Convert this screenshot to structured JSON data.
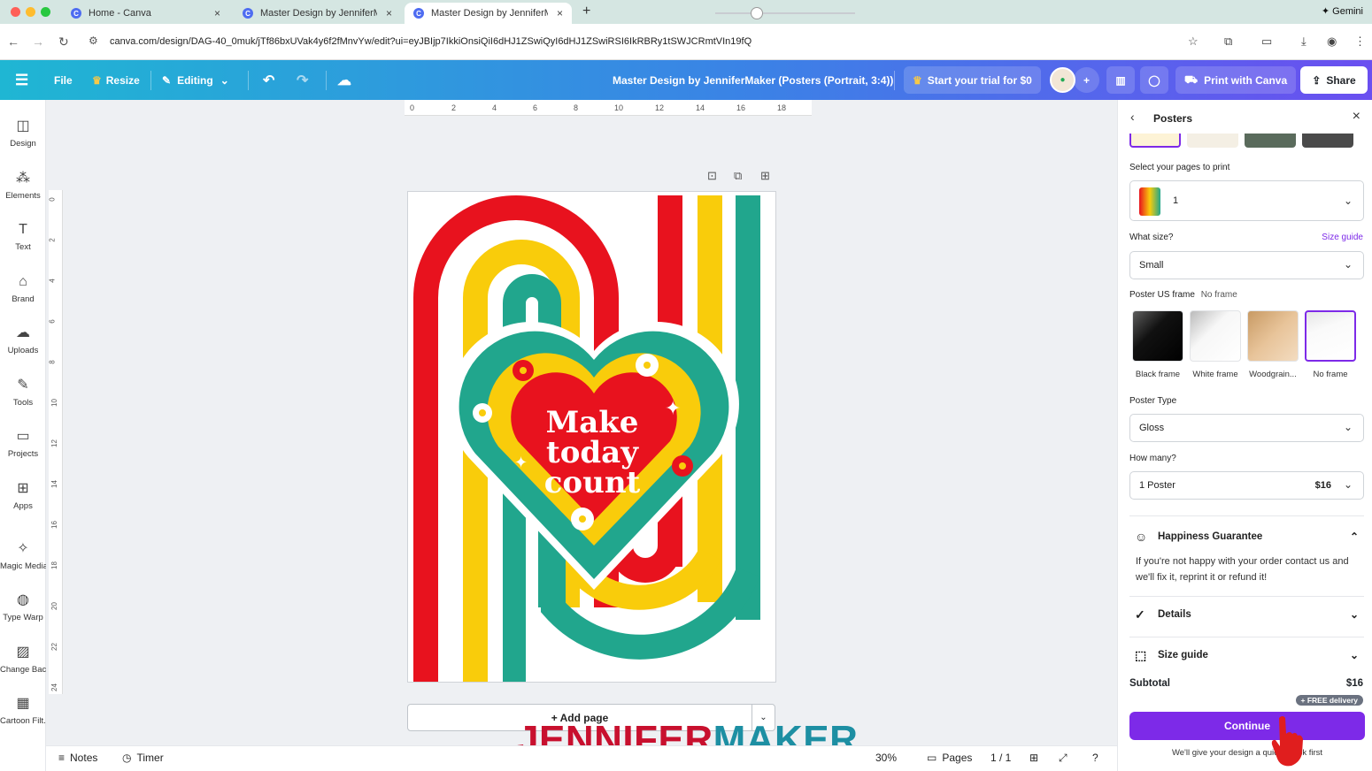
{
  "browser": {
    "tabs": [
      {
        "title": "Home - Canva",
        "active": false
      },
      {
        "title": "Master Design by JenniferMaker",
        "active": false
      },
      {
        "title": "Master Design by JenniferMaker",
        "active": true
      }
    ],
    "gemini_label": "Gemini",
    "url": "canva.com/design/DAG-40_0muk/jTf86bxUVak4y6f2fMnvYw/edit?ui=eyJBIjp7IkkiOnsiQiI6dHJ1ZSwiQyI6dHJ1ZSwiRSI6IkRBRy1tSWJCRmtVIn19fQ"
  },
  "canva_header": {
    "file_label": "File",
    "resize_label": "Resize",
    "editing_label": "Editing",
    "design_title": "Master Design by JenniferMaker (Posters (Portrait, 3:4))",
    "trial_label": "Start your trial for $0",
    "print_label": "Print with Canva",
    "share_label": "Share"
  },
  "sidebar": {
    "items": [
      {
        "label": "Design",
        "icon": "design-icon"
      },
      {
        "label": "Elements",
        "icon": "elements-icon"
      },
      {
        "label": "Text",
        "icon": "text-icon"
      },
      {
        "label": "Brand",
        "icon": "brand-icon"
      },
      {
        "label": "Uploads",
        "icon": "uploads-icon"
      },
      {
        "label": "Tools",
        "icon": "tools-icon"
      },
      {
        "label": "Projects",
        "icon": "projects-icon"
      },
      {
        "label": "Apps",
        "icon": "apps-icon"
      },
      {
        "label": "Magic Media",
        "icon": "magic-media-icon"
      },
      {
        "label": "Type Warp",
        "icon": "type-warp-icon"
      },
      {
        "label": "Change Bac...",
        "icon": "change-background-icon"
      },
      {
        "label": "Cartoon Filt...",
        "icon": "cartoon-filter-icon"
      }
    ]
  },
  "ruler": {
    "top_ticks": [
      "0",
      "2",
      "4",
      "6",
      "8",
      "10",
      "12",
      "14",
      "16",
      "18"
    ],
    "left_ticks": [
      "0",
      "2",
      "4",
      "6",
      "8",
      "10",
      "12",
      "14",
      "16",
      "18",
      "20",
      "22",
      "24"
    ]
  },
  "poster": {
    "text_lines": [
      "Make",
      "today",
      "count"
    ],
    "colors": {
      "red": "#e8121e",
      "yellow": "#f9cc0b",
      "teal": "#21a68d",
      "white": "#ffffff"
    }
  },
  "canvas": {
    "add_page_label": "+ Add page"
  },
  "bottom_bar": {
    "notes_label": "Notes",
    "timer_label": "Timer",
    "zoom": "30%",
    "pages_label": "Pages",
    "page_count": "1 / 1"
  },
  "watermark": {
    "part1": "JENNIFER",
    "part2": "MAKER"
  },
  "panel": {
    "title": "Posters",
    "select_pages_label": "Select your pages to print",
    "page_selected": "1",
    "size_label": "What size?",
    "size_guide_link": "Size guide",
    "size_value": "Small",
    "frame_label": "Poster US frame",
    "frame_value": "No frame",
    "frames": [
      {
        "label": "Black frame"
      },
      {
        "label": "White frame"
      },
      {
        "label": "Woodgrain..."
      },
      {
        "label": "No frame",
        "selected": true
      }
    ],
    "poster_type_label": "Poster Type",
    "poster_type_value": "Gloss",
    "how_many_label": "How many?",
    "quantity_value": "1 Poster",
    "quantity_price": "$16",
    "guarantee_title": "Happiness Guarantee",
    "guarantee_text": "If you're not happy with your order contact us and we'll fix it, reprint it or refund it!",
    "details_title": "Details",
    "size_guide_title": "Size guide",
    "subtotal_label": "Subtotal",
    "subtotal_value": "$16",
    "free_delivery": "+ FREE delivery",
    "continue_label": "Continue",
    "bottom_note": "We'll give your design a quick check first"
  },
  "accent_colors": {
    "canva_purple": "#7d2ae8",
    "header_start": "#1fb6d3",
    "header_end": "#6a4ff0"
  }
}
